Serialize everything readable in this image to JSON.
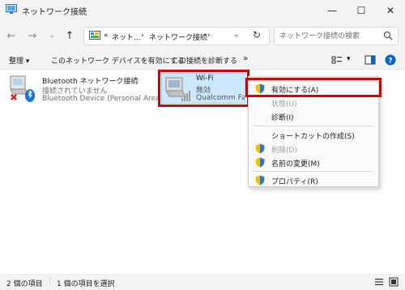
{
  "window": {
    "title": "ネットワーク接続",
    "minimize_glyph": "—",
    "maximize_glyph": "☐",
    "close_glyph": "✕"
  },
  "nav": {
    "back": "←",
    "forward": "→",
    "recent": "⌄",
    "up": "↑"
  },
  "address": {
    "overflow": "«",
    "crumbs": [
      "ネット...",
      "ネットワーク接続"
    ],
    "separator": "›",
    "dropdown": "⌄",
    "refresh": "↻"
  },
  "search": {
    "placeholder": "ネットワーク接続の検索"
  },
  "toolbar": {
    "organize": "整理 ▾",
    "enable_device": "このネットワーク デバイスを有効にする",
    "diagnose": "この接続を診断する",
    "more": "»",
    "view_dropdown": "▾"
  },
  "connections": [
    {
      "name": "Bluetooth ネットワーク接続",
      "status": "接続されていません",
      "device": "Bluetooth Device (Personal Area ..."
    },
    {
      "name": "Wi-Fi",
      "status": "無効",
      "device": "Qualcomm FastConnect"
    }
  ],
  "context_menu": {
    "items": [
      {
        "label": "有効にする(A)",
        "disabled": false,
        "icon": "shield-icon"
      },
      {
        "label": "状態(U)",
        "disabled": true,
        "icon": ""
      },
      {
        "label": "診断(I)",
        "disabled": false,
        "icon": ""
      },
      {
        "label": "ショートカットの作成(S)",
        "disabled": false,
        "icon": ""
      },
      {
        "label": "削除(D)",
        "disabled": true,
        "icon": "shield-icon"
      },
      {
        "label": "名前の変更(M)",
        "disabled": false,
        "icon": "shield-icon"
      },
      {
        "label": "プロパティ(R)",
        "disabled": false,
        "icon": "shield-icon"
      }
    ]
  },
  "status": {
    "count": "2 個の項目",
    "selected": "1 個の項目を選択"
  },
  "colors": {
    "highlight_red": "#d40000",
    "selection_blue": "#cce8ff",
    "accent_blue": "#0067c0"
  }
}
